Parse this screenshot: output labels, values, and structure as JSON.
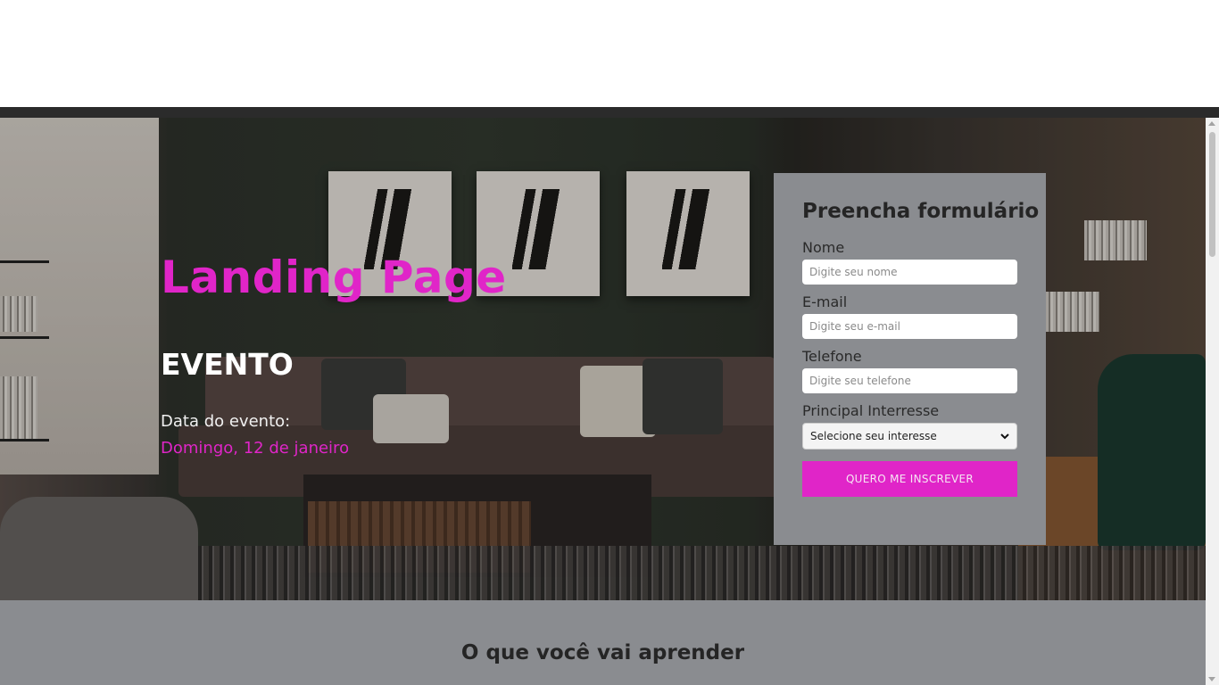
{
  "hero": {
    "title": "Landing Page",
    "subtitle": "EVENTO",
    "date_label": "Data do evento:",
    "date_value": "Domingo, 12 de janeiro"
  },
  "form": {
    "title": "Preencha formulário",
    "fields": [
      {
        "label": "Nome",
        "placeholder": "Digite seu nome",
        "value": ""
      },
      {
        "label": "E-mail",
        "placeholder": "Digite seu e-mail",
        "value": ""
      },
      {
        "label": "Telefone",
        "placeholder": "Digite seu telefone",
        "value": ""
      }
    ],
    "select": {
      "label": "Principal Interresse",
      "selected": "Selecione seu interesse",
      "icon": "chevron-down-icon"
    },
    "submit_label": "QUERO ME INSCREVER"
  },
  "learn_section": {
    "title": "O que você vai aprender"
  },
  "colors": {
    "accent": "#e025c8",
    "panel": "#8a8c90"
  }
}
